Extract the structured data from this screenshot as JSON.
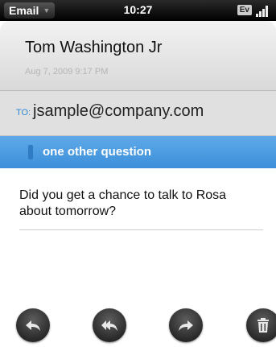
{
  "status_bar": {
    "app_name": "Email",
    "time": "10:27",
    "carrier_badge": "Ev",
    "icons": [
      "menu-caret-icon",
      "signal-strength-icon"
    ]
  },
  "message": {
    "sender": "Tom Washington Jr",
    "date": "Aug 7, 2009  9:17 PM",
    "to_label": "TO:",
    "to_address": "jsample@company.com",
    "subject": "one other question",
    "body": "Did you get a chance to talk to Rosa about tomorrow?"
  },
  "toolbar": {
    "buttons": [
      {
        "name": "reply-button",
        "icon": "reply-icon"
      },
      {
        "name": "reply-all-button",
        "icon": "reply-all-icon"
      },
      {
        "name": "forward-button",
        "icon": "forward-icon"
      },
      {
        "name": "delete-button",
        "icon": "trash-icon"
      }
    ]
  },
  "colors": {
    "subject_bar": "#4a9ce2",
    "to_label": "#2e86d7",
    "status_bar": "#000000"
  }
}
